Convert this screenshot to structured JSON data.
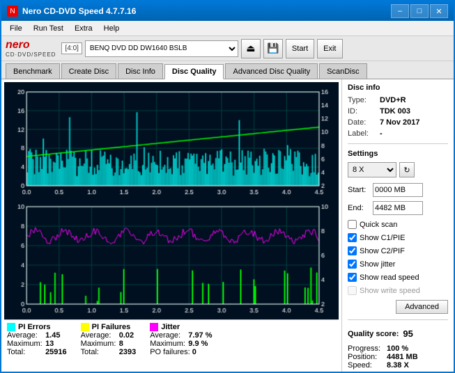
{
  "window": {
    "title": "Nero CD-DVD Speed 4.7.7.16",
    "controls": [
      "minimize",
      "maximize",
      "close"
    ]
  },
  "menu": {
    "items": [
      "File",
      "Run Test",
      "Extra",
      "Help"
    ]
  },
  "toolbar": {
    "logo": "nero",
    "logo_sub": "CD·DVD/SPEED",
    "drive_label": "[4:0]",
    "drive_name": "BENQ DVD DD DW1640 BSLB",
    "start_label": "Start",
    "stop_label": "Exit"
  },
  "tabs": [
    {
      "label": "Benchmark",
      "active": false
    },
    {
      "label": "Create Disc",
      "active": false
    },
    {
      "label": "Disc Info",
      "active": false
    },
    {
      "label": "Disc Quality",
      "active": true
    },
    {
      "label": "Advanced Disc Quality",
      "active": false
    },
    {
      "label": "ScanDisc",
      "active": false
    }
  ],
  "disc_info": {
    "section_title": "Disc info",
    "type_label": "Type:",
    "type_value": "DVD+R",
    "id_label": "ID:",
    "id_value": "TDK 003",
    "date_label": "Date:",
    "date_value": "7 Nov 2017",
    "label_label": "Label:",
    "label_value": "-"
  },
  "settings": {
    "section_title": "Settings",
    "speed_value": "8 X",
    "start_label": "Start:",
    "start_value": "0000 MB",
    "end_label": "End:",
    "end_value": "4482 MB",
    "quick_scan_label": "Quick scan",
    "quick_scan_checked": false,
    "show_c1pie_label": "Show C1/PIE",
    "show_c1pie_checked": true,
    "show_c2pif_label": "Show C2/PIF",
    "show_c2pif_checked": true,
    "show_jitter_label": "Show jitter",
    "show_jitter_checked": true,
    "show_read_speed_label": "Show read speed",
    "show_read_speed_checked": true,
    "show_write_speed_label": "Show write speed",
    "show_write_speed_checked": false,
    "advanced_label": "Advanced"
  },
  "quality": {
    "score_label": "Quality score:",
    "score_value": "95"
  },
  "progress": {
    "progress_label": "Progress:",
    "progress_value": "100 %",
    "position_label": "Position:",
    "position_value": "4481 MB",
    "speed_label": "Speed:",
    "speed_value": "8.38 X"
  },
  "stats": {
    "pi_errors": {
      "label": "PI Errors",
      "color": "#00ffff",
      "average_label": "Average:",
      "average_value": "1.45",
      "maximum_label": "Maximum:",
      "maximum_value": "13",
      "total_label": "Total:",
      "total_value": "25916"
    },
    "pi_failures": {
      "label": "PI Failures",
      "color": "#ffff00",
      "average_label": "Average:",
      "average_value": "0.02",
      "maximum_label": "Maximum:",
      "maximum_value": "8",
      "total_label": "Total:",
      "total_value": "2393"
    },
    "jitter": {
      "label": "Jitter",
      "color": "#ff00ff",
      "average_label": "Average:",
      "average_value": "7.97 %",
      "maximum_label": "Maximum:",
      "maximum_value": "9.9 %"
    },
    "po_failures": {
      "label": "PO failures:",
      "value": "0"
    }
  },
  "chart1": {
    "y_max": 20,
    "y_right_max": 16,
    "x_max": 4.5,
    "x_labels": [
      "0.0",
      "0.5",
      "1.0",
      "1.5",
      "2.0",
      "2.5",
      "3.0",
      "3.5",
      "4.0",
      "4.5"
    ],
    "y_labels_left": [
      "20",
      "16",
      "12",
      "8",
      "4",
      "0"
    ],
    "y_labels_right": [
      "16",
      "14",
      "12",
      "10",
      "8",
      "6",
      "4",
      "2"
    ]
  },
  "chart2": {
    "y_max": 10,
    "x_max": 4.5,
    "x_labels": [
      "0.0",
      "0.5",
      "1.0",
      "1.5",
      "2.0",
      "2.5",
      "3.0",
      "3.5",
      "4.0",
      "4.5"
    ],
    "y_labels_left": [
      "10",
      "8",
      "6",
      "4",
      "2",
      "0"
    ],
    "y_labels_right": [
      "10",
      "8",
      "6",
      "4",
      "2"
    ]
  }
}
